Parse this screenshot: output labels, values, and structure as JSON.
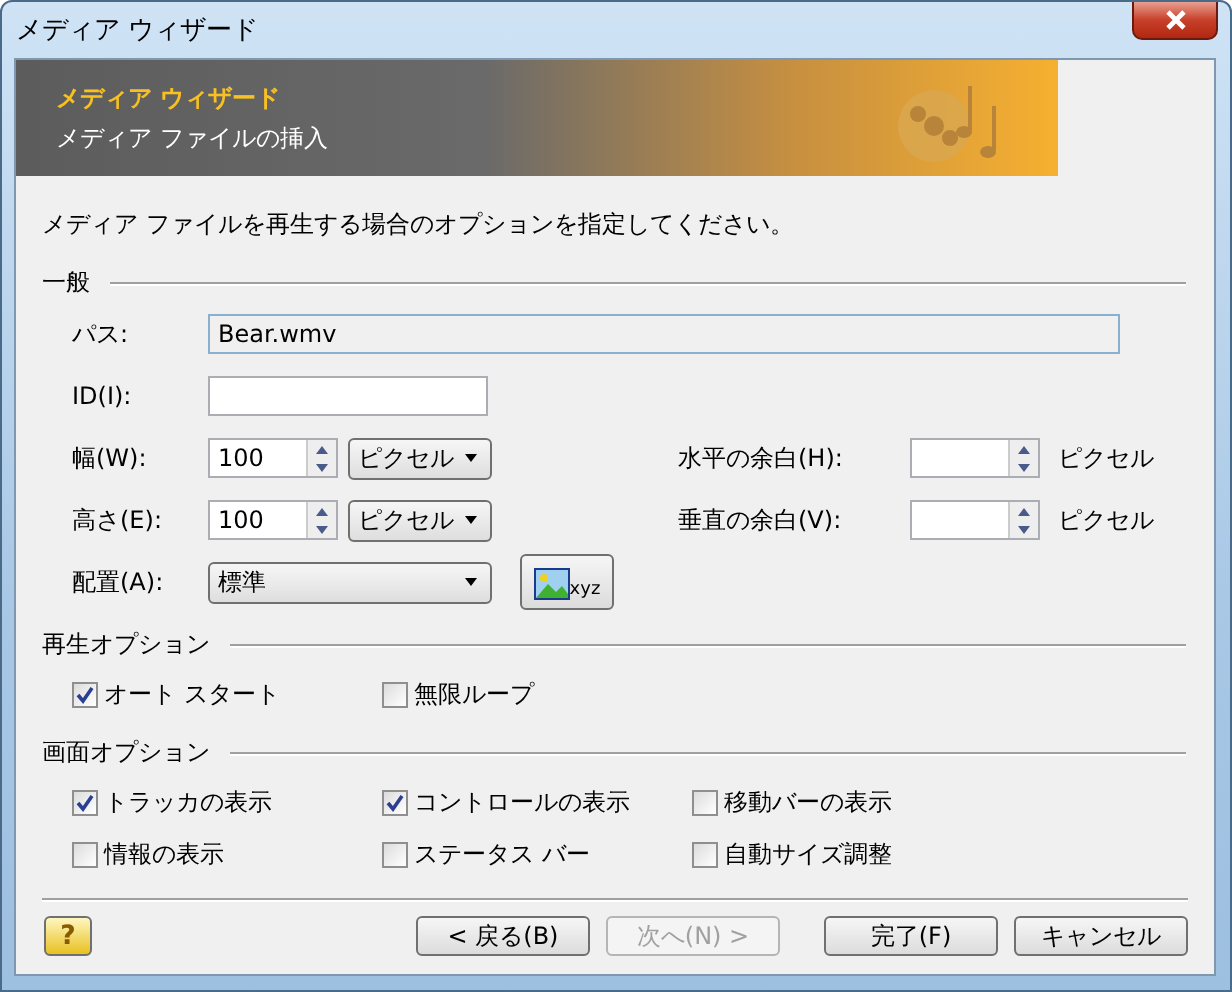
{
  "window": {
    "title": "メディア ウィザード"
  },
  "header": {
    "title": "メディア ウィザード",
    "subtitle": "メディア ファイルの挿入"
  },
  "instruction": "メディア ファイルを再生する場合のオプションを指定してください。",
  "general": {
    "heading": "一般",
    "path": {
      "label": "パス:",
      "value": "Bear.wmv"
    },
    "id": {
      "label": "ID(I):"
    },
    "width": {
      "label": "幅(W):",
      "value": "100",
      "unit": "ピクセル"
    },
    "height": {
      "label": "高さ(E):",
      "value": "100",
      "unit": "ピクセル"
    },
    "h_margin": {
      "label": "水平の余白(H):",
      "unit": "ピクセル"
    },
    "v_margin": {
      "label": "垂直の余白(V):",
      "unit": "ピクセル"
    },
    "align": {
      "label": "配置(A):",
      "value": "標準",
      "button_text": "xyz"
    }
  },
  "playback": {
    "heading": "再生オプション",
    "options": [
      {
        "label": "オート スタート",
        "checked": true
      },
      {
        "label": "無限ループ",
        "checked": false
      }
    ]
  },
  "display": {
    "heading": "画面オプション",
    "options": [
      {
        "label": "トラッカの表示",
        "checked": true
      },
      {
        "label": "コントロールの表示",
        "checked": true
      },
      {
        "label": "移動バーの表示",
        "checked": false
      },
      {
        "label": "情報の表示",
        "checked": false
      },
      {
        "label": "ステータス バー",
        "checked": false
      },
      {
        "label": "自動サイズ調整",
        "checked": false
      }
    ]
  },
  "help": {
    "label": "?"
  },
  "buttons": [
    {
      "label": "< 戻る(B)",
      "disabled": false
    },
    {
      "label": "次へ(N) >",
      "disabled": true
    },
    {
      "label": "完了(F)",
      "disabled": false
    },
    {
      "label": "キャンセル",
      "disabled": false
    }
  ]
}
